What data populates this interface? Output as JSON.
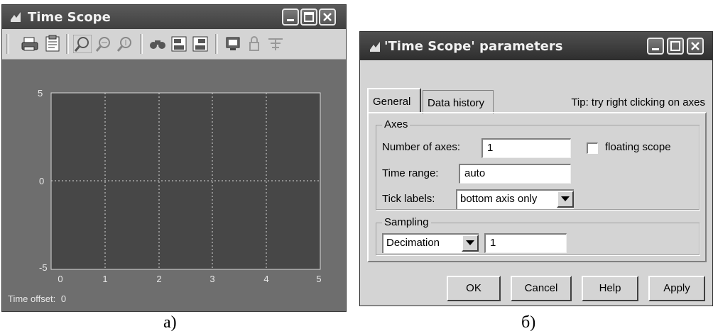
{
  "scope_window": {
    "title": "Time Scope",
    "y_ticks": [
      "5",
      "0",
      "-5"
    ],
    "x_ticks": [
      "0",
      "1",
      "2",
      "3",
      "4",
      "5"
    ],
    "time_offset_label": "Time offset:",
    "time_offset_value": "0",
    "toolbar_icons": [
      "print-icon",
      "parameters-icon",
      "zoom-icon",
      "zoom-x-icon",
      "zoom-y-icon",
      "autoscale-icon",
      "save-axes-icon",
      "restore-axes-icon",
      "floating-scope-icon",
      "lock-icon",
      "signal-selection-icon"
    ]
  },
  "params_window": {
    "title": "'Time Scope' parameters",
    "tabs": [
      {
        "label": "General"
      },
      {
        "label": "Data history"
      }
    ],
    "tip": "Tip: try right clicking on axes",
    "axes_group": {
      "legend": "Axes",
      "number_of_axes_label": "Number of axes:",
      "number_of_axes_value": "1",
      "floating_scope_label": "floating scope",
      "time_range_label": "Time range:",
      "time_range_value": "auto",
      "tick_labels_label": "Tick labels:",
      "tick_labels_value": "bottom axis only"
    },
    "sampling_group": {
      "legend": "Sampling",
      "mode_value": "Decimation",
      "factor_value": "1"
    },
    "buttons": {
      "ok": "OK",
      "cancel": "Cancel",
      "help": "Help",
      "apply": "Apply"
    }
  },
  "captions": {
    "a": "а)",
    "b": "б)"
  },
  "colors": {
    "plot_background": "#474747",
    "plot_grid": "#d8d8d8",
    "dialog_face": "#d4d4d4"
  }
}
